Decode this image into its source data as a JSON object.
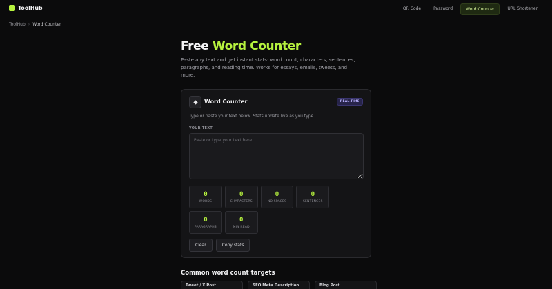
{
  "brand": {
    "name": "ToolHub"
  },
  "nav": [
    {
      "label": "QR Code",
      "active": false
    },
    {
      "label": "Password",
      "active": false
    },
    {
      "label": "Word Counter",
      "active": true
    },
    {
      "label": "URL Shortener",
      "active": false
    }
  ],
  "breadcrumb": {
    "home": "ToolHub",
    "separator": "›",
    "current": "Word Counter"
  },
  "hero": {
    "title_prefix": "Free",
    "title_accent": "Word Counter",
    "description": "Paste any text and get instant stats: word count, characters, sentences, paragraphs, and reading time. Works for essays, emails, tweets, and more."
  },
  "card": {
    "icon": "diamond-icon",
    "title": "Word Counter",
    "badge": "REAL-TIME",
    "hint": "Type or paste your text below. Stats update live as you type.",
    "field_label": "YOUR TEXT",
    "textarea": {
      "value": "",
      "placeholder": "Paste or type your text here..."
    },
    "stats": [
      {
        "value": "0",
        "label": "WORDS"
      },
      {
        "value": "0",
        "label": "CHARACTERS"
      },
      {
        "value": "0",
        "label": "NO SPACES"
      },
      {
        "value": "0",
        "label": "SENTENCES"
      },
      {
        "value": "0",
        "label": "PARAGRAPHS"
      },
      {
        "value": "0",
        "label": "MIN READ"
      }
    ],
    "actions": {
      "clear": "Clear",
      "copy": "Copy stats"
    }
  },
  "targets_section": {
    "title": "Common word count targets",
    "items": [
      "Tweet / X Post",
      "SEO Meta Description",
      "Blog Post"
    ]
  },
  "colors": {
    "accent": "#b6f23e",
    "badge": "#b9b2ff",
    "background": "#0b0b0c"
  }
}
